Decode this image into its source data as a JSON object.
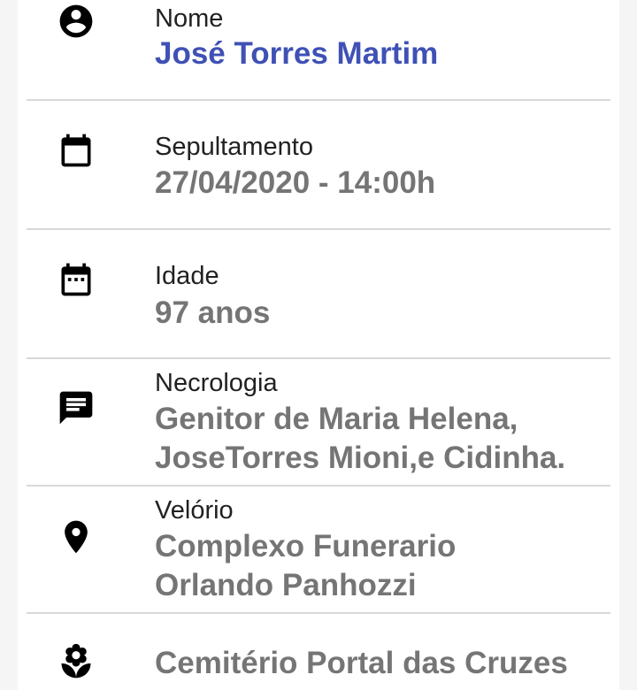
{
  "details": {
    "name": {
      "label": "Nome",
      "value": "José Torres Martim",
      "icon": "account-circle-icon"
    },
    "burial": {
      "label": "Sepultamento",
      "value": "27/04/2020 - 14:00h",
      "icon": "calendar-icon"
    },
    "age": {
      "label": "Idade",
      "value": "97 anos",
      "icon": "calendar-dots-icon"
    },
    "obituary": {
      "label": "Necrologia",
      "line1": "Genitor de Maria Helena,",
      "line2": "JoseTorres Mioni,e Cidinha.",
      "icon": "message-icon"
    },
    "wake": {
      "label": "Velório",
      "line1": "Complexo Funerario",
      "line2": "Orlando Panhozzi",
      "icon": "location-pin-icon"
    },
    "cemetery": {
      "value": "Cemitério Portal das Cruzes",
      "icon": "flower-icon"
    }
  },
  "colors": {
    "name_accent": "#3f51b5",
    "value_gray": "#757575",
    "label_dark": "#212121",
    "divider": "#d8d8d8"
  }
}
